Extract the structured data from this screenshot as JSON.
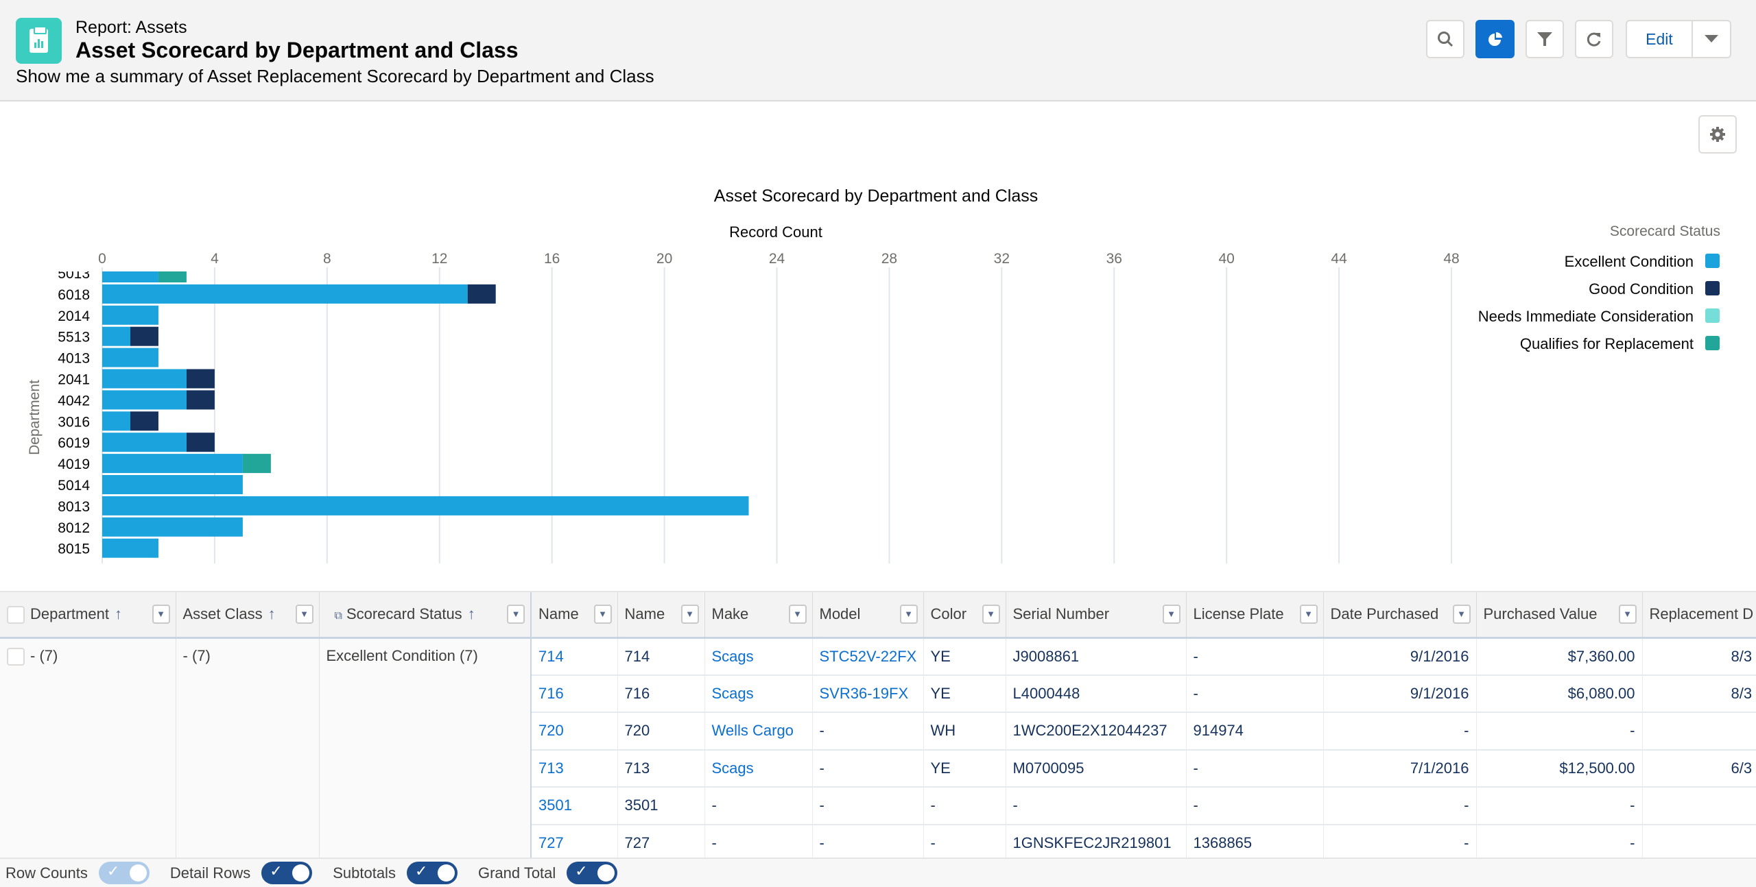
{
  "header": {
    "eyebrow": "Report: Assets",
    "title": "Asset Scorecard by Department and Class",
    "subtitle": "Show me a summary of Asset Replacement Scorecard by Department and Class",
    "edit_label": "Edit"
  },
  "icons": [
    "report-icon",
    "search-icon",
    "chart-icon",
    "filter-icon",
    "refresh-icon",
    "chevron-down-icon",
    "gear-icon"
  ],
  "colors": {
    "excellent": "#1ba3dd",
    "good": "#16325c",
    "needs": "#76ded9",
    "qualifies": "#22a699",
    "accent": "#0f70d0",
    "link": "#0b6fd0"
  },
  "chart_data": {
    "type": "bar",
    "orientation": "horizontal",
    "stacked": true,
    "title": "Asset Scorecard by Department and Class",
    "xlabel": "Record Count",
    "ylabel": "Department",
    "xlim": [
      0,
      48
    ],
    "xticks": [
      0,
      4,
      8,
      12,
      16,
      20,
      24,
      28,
      32,
      36,
      40,
      44,
      48
    ],
    "grid": true,
    "legend_title": "Scorecard Status",
    "legend_position": "right",
    "categories": [
      "5013",
      "6018",
      "2014",
      "5513",
      "4013",
      "2041",
      "4042",
      "3016",
      "6019",
      "4019",
      "5014",
      "8013",
      "8012",
      "8015"
    ],
    "series": [
      {
        "name": "Excellent Condition",
        "color": "#1ba3dd",
        "values": [
          2,
          13,
          2,
          1,
          2,
          3,
          3,
          1,
          3,
          5,
          5,
          23,
          5,
          2
        ]
      },
      {
        "name": "Good Condition",
        "color": "#16325c",
        "values": [
          0,
          1,
          0,
          1,
          0,
          1,
          1,
          1,
          1,
          0,
          0,
          0,
          0,
          0
        ]
      },
      {
        "name": "Needs Immediate Consideration",
        "color": "#76ded9",
        "values": [
          0,
          0,
          0,
          0,
          0,
          0,
          0,
          0,
          0,
          0,
          0,
          0,
          0,
          0
        ]
      },
      {
        "name": "Qualifies for Replacement",
        "color": "#22a699",
        "values": [
          1,
          0,
          0,
          0,
          0,
          0,
          0,
          0,
          0,
          1,
          0,
          0,
          0,
          0
        ]
      }
    ]
  },
  "table": {
    "columns": [
      "Department",
      "Asset Class",
      "Scorecard Status",
      "Name",
      "Name",
      "Make",
      "Model",
      "Color",
      "Serial Number",
      "License Plate",
      "Date Purchased",
      "Purchased Value",
      "Replacement D"
    ],
    "group": {
      "department": "- (7)",
      "asset_class": "- (7)",
      "status": "Excellent Condition (7)"
    },
    "rows": [
      [
        "714",
        "714",
        "Scags",
        "STC52V-22FX",
        "YE",
        "J9008861",
        "-",
        "9/1/2016",
        "$7,360.00",
        "8/3"
      ],
      [
        "716",
        "716",
        "Scags",
        "SVR36-19FX",
        "YE",
        "L4000448",
        "-",
        "9/1/2016",
        "$6,080.00",
        "8/3"
      ],
      [
        "720",
        "720",
        "Wells Cargo",
        "-",
        "WH",
        "1WC200E2X12044237",
        "914974",
        "-",
        "-",
        ""
      ],
      [
        "713",
        "713",
        "Scags",
        "-",
        "YE",
        "M0700095",
        "-",
        "7/1/2016",
        "$12,500.00",
        "6/3"
      ],
      [
        "3501",
        "3501",
        "-",
        "-",
        "-",
        "-",
        "-",
        "-",
        "-",
        ""
      ],
      [
        "727",
        "727",
        "-",
        "-",
        "-",
        "1GNSKFEC2JR219801",
        "1368865",
        "-",
        "-",
        ""
      ]
    ]
  },
  "footer": {
    "row_counts": "Row Counts",
    "row_counts_on": true,
    "row_counts_disabled": true,
    "detail_rows": "Detail Rows",
    "detail_rows_on": true,
    "subtotals": "Subtotals",
    "subtotals_on": true,
    "grand_total": "Grand Total",
    "grand_total_on": true
  }
}
